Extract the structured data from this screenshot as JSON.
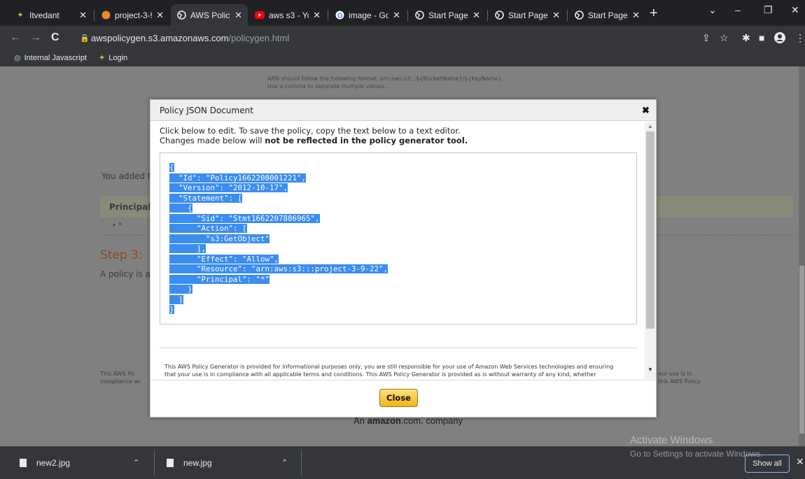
{
  "browser": {
    "tabs": [
      {
        "title": "Itvedant",
        "icon": "itvedant-logo-icon"
      },
      {
        "title": "project-3-9",
        "icon": "aws-s3-bucket-icon"
      },
      {
        "title": "AWS Policy",
        "icon": "globe-icon"
      },
      {
        "title": "aws s3 - Yo",
        "icon": "youtube-icon"
      },
      {
        "title": "image - Go",
        "icon": "google-icon"
      },
      {
        "title": "Start Page",
        "icon": "globe-icon"
      },
      {
        "title": "Start Page",
        "icon": "globe-icon"
      },
      {
        "title": "Start Page",
        "icon": "globe-icon"
      }
    ],
    "url_host": "awspolicygen.s3.amazonaws.com",
    "url_path": "/policygen.html",
    "bookmarks": [
      {
        "label": "Internal Javascript",
        "icon": "globe-icon"
      },
      {
        "label": "Login",
        "icon": "itvedant-logo-icon"
      }
    ]
  },
  "page": {
    "arn_note_line1": "ARN should follow the following format: arn:aws:s3:::${BucketName}/${KeyName}.",
    "arn_note_line2": "Use a comma to separate multiple values.",
    "added_text": "You added t",
    "table_header": "Principal",
    "bullet": "• *",
    "step3": "Step 3:",
    "policy_text": "A policy is a",
    "footer_left_1": "This AWS Po",
    "footer_left_2": "compliance wi",
    "footer_right_1": "our use is in",
    "footer_right_2": "this AWS Policy",
    "amazon_prefix": "An",
    "amazon_brand": "amazon",
    "amazon_suffix": ".com. company"
  },
  "modal": {
    "title": "Policy JSON Document",
    "instruction_line1": "Click below to edit. To save the policy, copy the text below to a text editor.",
    "instruction_line2_prefix": "Changes made below will ",
    "instruction_line2_bold": "not be reflected in the policy generator tool.",
    "json_lines": [
      "{",
      "  \"Id\": \"Policy1662208001221\",",
      "  \"Version\": \"2012-10-17\",",
      "  \"Statement\": [",
      "    {",
      "      \"Sid\": \"Stmt1662207886965\",",
      "      \"Action\": [",
      "        \"s3:GetObject\"",
      "      ],",
      "      \"Effect\": \"Allow\",",
      "      \"Resource\": \"arn:aws:s3:::project-3-9-22\",",
      "      \"Principal\": \"*\"",
      "    }",
      "  ]",
      "}"
    ],
    "disclaimer_line1": "This AWS Policy Generator is provided for informational purposes only, you are still responsible for your use of Amazon Web Services technologies and ensuring",
    "disclaimer_line2": "that your use is in compliance with all applicable terms and conditions. This AWS Policy Generator is provided as is without warranty of any kind, whether",
    "close_label": "Close"
  },
  "downloads": {
    "items": [
      {
        "name": "new2.jpg"
      },
      {
        "name": "new.jpg"
      }
    ],
    "show_all": "Show all"
  },
  "os_watermark": {
    "line1": "Activate Windows",
    "line2": "Go to Settings to activate Windows."
  },
  "colors": {
    "selection": "#3b8df0",
    "close_button": "#f2b51c",
    "overlay": "#808080"
  }
}
